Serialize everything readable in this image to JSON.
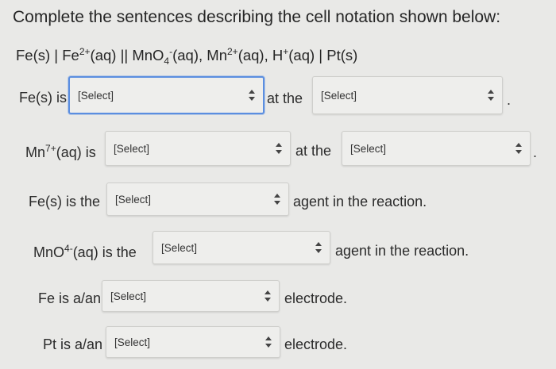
{
  "heading": "Complete the sentences describing the cell notation shown below:",
  "notation": {
    "fe": "Fe(s) | Fe",
    "fe_sup": "2+",
    "aq1": "(aq) || MnO",
    "mno_sub": "4",
    "mno_sup": "-",
    "aq2": "(aq), Mn",
    "mn_sup": "2+",
    "aq3": "(aq), H",
    "h_sup": "+",
    "aq4": "(aq) | Pt(s)"
  },
  "row1": {
    "label": "Fe(s) is",
    "select1": "[Select]",
    "mid": "at the",
    "select2": "[Select]",
    "end": "."
  },
  "row2": {
    "label_pre": "Mn",
    "label_sup": "7+",
    "label_post": "(aq) is",
    "select1": "[Select]",
    "mid": "at the",
    "select2": "[Select]",
    "end": "."
  },
  "row3": {
    "label": "Fe(s) is the",
    "select": "[Select]",
    "post": "agent in the reaction."
  },
  "row4": {
    "label_pre": "MnO",
    "label_sup": "4-",
    "label_post": "(aq) is the",
    "select": "[Select]",
    "post": "agent in the reaction."
  },
  "row5": {
    "label": "Fe is a/an",
    "select": "[Select]",
    "post": "electrode."
  },
  "row6": {
    "label": "Pt is a/an",
    "select": "[Select]",
    "post": "electrode."
  }
}
